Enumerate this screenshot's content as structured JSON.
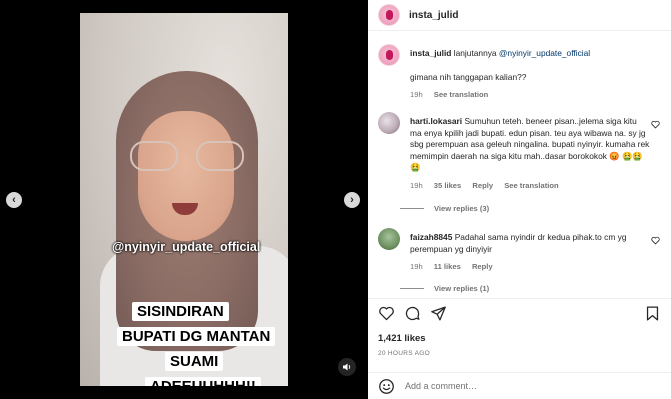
{
  "post": {
    "author": "insta_julid",
    "watermark": "@nyinyir_update_official",
    "captions": [
      "SISINDIRAN",
      "BUPATI DG MANTAN",
      "SUAMI",
      "ADEEUUHHH!!"
    ]
  },
  "caption_comment": {
    "username": "insta_julid",
    "text_prefix": "lanjutannya ",
    "mention": "@nyinyir_update_official",
    "text_line2": "gimana nih tanggapan kalian??",
    "time": "19h",
    "see_translation": "See translation"
  },
  "comments": [
    {
      "username": "harti.lokasari",
      "text": "Sumuhun teteh. beneer pisan..jelema siga kitu ma enya kpilih jadi bupati. edun pisan. teu aya wibawa na. sy jg sbg perempuan asa geleuh ningalina. bupati nyinyir. kumaha rek memimpin daerah na siga kitu mah..dasar borokokok 😡 🤮🤮🤮",
      "time": "19h",
      "likes": "35 likes",
      "reply": "Reply",
      "see_translation": "See translation",
      "view_replies": "View replies (3)"
    },
    {
      "username": "faizah8845",
      "text": "Padahal sama nyindir dr kedua pihak.to cm yg perempuan yg dinyiyir",
      "time": "19h",
      "likes": "11 likes",
      "reply": "Reply",
      "view_replies": "View replies (1)"
    }
  ],
  "footer": {
    "likes": "1,421 likes",
    "date": "20 HOURS AGO",
    "add_comment_placeholder": "Add a comment…"
  },
  "icons": {
    "prev": "chevron-left-icon",
    "next": "chevron-right-icon",
    "mute": "speaker-icon",
    "like": "heart-icon",
    "comment": "comment-bubble-icon",
    "share": "paper-plane-icon",
    "save": "bookmark-icon",
    "emoji": "emoji-smiley-icon"
  },
  "colors": {
    "background": "#000000",
    "panel": "#ffffff",
    "text": "#262626",
    "secondary": "#737373",
    "mention": "#00376b"
  }
}
